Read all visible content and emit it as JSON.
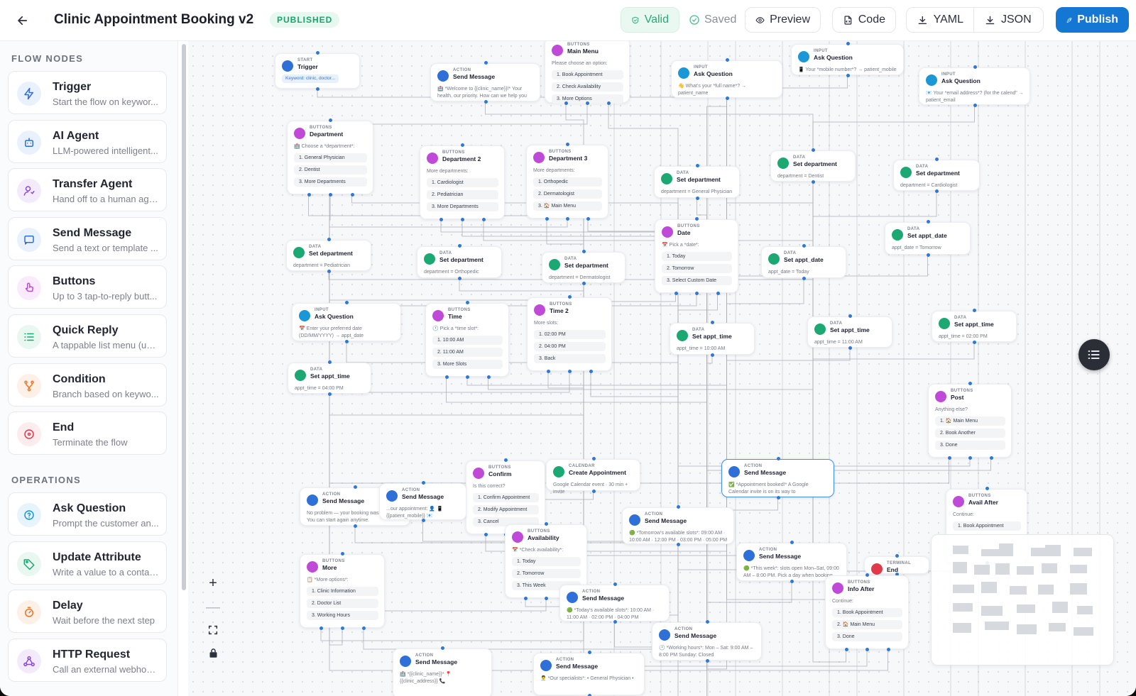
{
  "header": {
    "title": "Clinic Appointment Booking v2",
    "status": "PUBLISHED",
    "valid_label": "Valid",
    "saved_label": "Saved",
    "preview_label": "Preview",
    "code_label": "Code",
    "yaml_label": "YAML",
    "json_label": "JSON",
    "publish_label": "Publish"
  },
  "sidebar": {
    "flow_nodes_title": "FLOW NODES",
    "operations_title": "OPERATIONS",
    "flow_nodes": [
      {
        "name": "Trigger",
        "desc": "Start the flow on keywor...",
        "icon": "bolt-icon",
        "color": "#2f6fd8",
        "bg": "#e9f1fd"
      },
      {
        "name": "AI Agent",
        "desc": "LLM-powered intelligent...",
        "icon": "robot-icon",
        "color": "#2f6fd8",
        "bg": "#e9f1fd"
      },
      {
        "name": "Transfer Agent",
        "desc": "Hand off to a human age...",
        "icon": "person-icon",
        "color": "#8b47d6",
        "bg": "#f3ebfc"
      },
      {
        "name": "Send Message",
        "desc": "Send a text or template ...",
        "icon": "message-icon",
        "color": "#2f6fd8",
        "bg": "#e9f1fd"
      },
      {
        "name": "Buttons",
        "desc": "Up to 3 tap-to-reply butt...",
        "icon": "tap-icon",
        "color": "#c04ad8",
        "bg": "#f9ebfc"
      },
      {
        "name": "Quick Reply",
        "desc": "A tappable list menu (up...",
        "icon": "list-icon",
        "color": "#1ba873",
        "bg": "#e8f7f0"
      },
      {
        "name": "Condition",
        "desc": "Branch based on keywo...",
        "icon": "branch-icon",
        "color": "#e8762b",
        "bg": "#fdf0e6"
      },
      {
        "name": "End",
        "desc": "Terminate the flow",
        "icon": "stop-icon",
        "color": "#e0394a",
        "bg": "#fdecee"
      }
    ],
    "operations": [
      {
        "name": "Ask Question",
        "desc": "Prompt the customer an...",
        "icon": "question-icon",
        "color": "#1b96d6",
        "bg": "#e7f4fb"
      },
      {
        "name": "Update Attribute",
        "desc": "Write a value to a contac...",
        "icon": "tag-icon",
        "color": "#1ba873",
        "bg": "#e8f7f0"
      },
      {
        "name": "Delay",
        "desc": "Wait before the next step",
        "icon": "timer-icon",
        "color": "#e8762b",
        "bg": "#fdf0e6"
      },
      {
        "name": "HTTP Request",
        "desc": "Call an external webhoo...",
        "icon": "webhook-icon",
        "color": "#8b47d6",
        "bg": "#f3ebfc"
      }
    ]
  },
  "canvas": {
    "nodes": [
      {
        "kind": "START",
        "title": "Trigger",
        "chip": "Keyword: clinic, doctor...",
        "icon_color": "#2f6fd8"
      },
      {
        "kind": "ACTION",
        "title": "Send Message",
        "body": "🏥 *Welcome to {{clinic_name}}!* Your health, our priority. How can we help you today?",
        "icon_color": "#2f6fd8"
      },
      {
        "kind": "BUTTONS",
        "title": "Main Menu",
        "body": "Please choose an option:",
        "options": [
          "1. Book Appointment",
          "2. Check Availability",
          "3. More Options"
        ],
        "icon_color": "#c04ad8"
      },
      {
        "kind": "INPUT",
        "title": "Ask Question",
        "body": "👋 What's your *full name*? → patient_name",
        "icon_color": "#1b96d6"
      },
      {
        "kind": "INPUT",
        "title": "Ask Question",
        "body": "📱 Your *mobile number*? → patient_mobile",
        "icon_color": "#1b96d6"
      },
      {
        "kind": "INPUT",
        "title": "Ask Question",
        "body": "📧 Your *email address*? (for the calend\" → patient_email",
        "icon_color": "#1b96d6"
      },
      {
        "kind": "BUTTONS",
        "title": "Department",
        "body": "🏥 Choose a *department*:",
        "options": [
          "1. General Physician",
          "2. Dentist",
          "3. More Departments"
        ],
        "icon_color": "#c04ad8"
      },
      {
        "kind": "BUTTONS",
        "title": "Department 2",
        "body": "More departments:",
        "options": [
          "1. Cardiologist",
          "2. Pediatrician",
          "3. More Departments"
        ],
        "icon_color": "#c04ad8"
      },
      {
        "kind": "BUTTONS",
        "title": "Department 3",
        "body": "More departments:",
        "options": [
          "1. Orthopedic",
          "2. Dermatologist",
          "3. 🏠 Main Menu"
        ],
        "icon_color": "#c04ad8"
      },
      {
        "kind": "DATA",
        "title": "Set department",
        "body": "department = General Physician",
        "icon_color": "#1ba873"
      },
      {
        "kind": "DATA",
        "title": "Set department",
        "body": "department = Dentist",
        "icon_color": "#1ba873"
      },
      {
        "kind": "DATA",
        "title": "Set department",
        "body": "department = Cardiologist",
        "icon_color": "#1ba873"
      },
      {
        "kind": "BUTTONS",
        "title": "Date",
        "body": "📅 Pick a *date*:",
        "options": [
          "1. Today",
          "2. Tomorrow",
          "3. Select Custom Date"
        ],
        "icon_color": "#c04ad8"
      },
      {
        "kind": "DATA",
        "title": "Set appt_date",
        "body": "appt_date = Tomorrow",
        "icon_color": "#1ba873"
      },
      {
        "kind": "DATA",
        "title": "Set appt_date",
        "body": "appt_date = Today",
        "icon_color": "#1ba873"
      },
      {
        "kind": "DATA",
        "title": "Set department",
        "body": "department = Pediatrician",
        "icon_color": "#1ba873"
      },
      {
        "kind": "DATA",
        "title": "Set department",
        "body": "department = Orthopedic",
        "icon_color": "#1ba873"
      },
      {
        "kind": "DATA",
        "title": "Set department",
        "body": "department = Dermatologist",
        "icon_color": "#1ba873"
      },
      {
        "kind": "INPUT",
        "title": "Ask Question",
        "body": "📅 Enter your preferred date (DD/MM/YYYY) → appt_date",
        "icon_color": "#1b96d6"
      },
      {
        "kind": "BUTTONS",
        "title": "Time",
        "body": "🕐 Pick a *time slot*:",
        "options": [
          "1. 10:00 AM",
          "2. 11:00 AM",
          "3. More Slots"
        ],
        "icon_color": "#c04ad8"
      },
      {
        "kind": "BUTTONS",
        "title": "Time 2",
        "body": "More slots:",
        "options": [
          "1. 02:00 PM",
          "2. 04:00 PM",
          "3. Back"
        ],
        "icon_color": "#c04ad8"
      },
      {
        "kind": "DATA",
        "title": "Set appt_time",
        "body": "appt_time = 10:00 AM",
        "icon_color": "#1ba873"
      },
      {
        "kind": "DATA",
        "title": "Set appt_time",
        "body": "appt_time = 11:00 AM",
        "icon_color": "#1ba873"
      },
      {
        "kind": "DATA",
        "title": "Set appt_time",
        "body": "appt_time = 02:00 PM",
        "icon_color": "#1ba873"
      },
      {
        "kind": "DATA",
        "title": "Set appt_time",
        "body": "appt_time = 04:00 PM",
        "icon_color": "#1ba873"
      },
      {
        "kind": "BUTTONS",
        "title": "Post",
        "body": "Anything else?",
        "options": [
          "1. 🏠 Main Menu",
          "2. Book Another",
          "3. Done"
        ],
        "icon_color": "#c04ad8"
      },
      {
        "kind": "BUTTONS",
        "title": "Confirm",
        "body": "Is this correct?",
        "options": [
          "1. Confirm Appointment",
          "2. Modify Appointment",
          "3. Cancel"
        ],
        "icon_color": "#c04ad8"
      },
      {
        "kind": "CALENDAR",
        "title": "Create Appointment",
        "body": "Google Calendar event · 30 min + invite",
        "icon_color": "#1ba873"
      },
      {
        "kind": "ACTION",
        "title": "Send Message",
        "body": "✅ *Appointment booked!* A Google Calendar invite is on its way to {{patient_email}} — tap...",
        "icon_color": "#2f6fd8"
      },
      {
        "kind": "ACTION",
        "title": "Send Message",
        "body": "No problem — your booking was cancelled. You can start again anytime.",
        "icon_color": "#2f6fd8"
      },
      {
        "kind": "ACTION",
        "title": "Send Message",
        "body": "...our appointment: 👤 📱 {{patient_mobile}} 📧",
        "icon_color": "#2f6fd8"
      },
      {
        "kind": "ACTION",
        "title": "Send Message",
        "body": "🟢 *Tomorrow's available slots*: 09:00 AM · 10:00 AM · 12:00 PM · 03:00 PM · 05:00 PM",
        "icon_color": "#2f6fd8"
      },
      {
        "kind": "BUTTONS",
        "title": "Availability",
        "body": "📅 *Check availability*:",
        "options": [
          "1. Today",
          "2. Tomorrow",
          "3. This Week"
        ],
        "icon_color": "#c04ad8"
      },
      {
        "kind": "ACTION",
        "title": "Send Message",
        "body": "🟢 *This week*: slots open Mon–Sat, 09:00 AM – 8:00 PM. Pick a day when booking.",
        "icon_color": "#2f6fd8"
      },
      {
        "kind": "TERMINAL",
        "title": "End",
        "icon_color": "#e0394a"
      },
      {
        "kind": "BUTTONS",
        "title": "Avail After",
        "body": "Continue:",
        "options": [
          "1. Book Appointment"
        ],
        "icon_color": "#c04ad8"
      },
      {
        "kind": "BUTTONS",
        "title": "More",
        "body": "📋 *More options*:",
        "options": [
          "1. Clinic Information",
          "2. Doctor List",
          "3. Working Hours"
        ],
        "icon_color": "#c04ad8"
      },
      {
        "kind": "ACTION",
        "title": "Send Message",
        "body": "🟢 *Today's available slots*: 10:00 AM · 11:00 AM · 02:00 PM · 04:00 PM",
        "icon_color": "#2f6fd8"
      },
      {
        "kind": "ACTION",
        "title": "Send Message",
        "body": "🕐 *Working hours*: Mon – Sat: 9:00 AM – 8:00 PM Sunday: Closed",
        "icon_color": "#2f6fd8"
      },
      {
        "kind": "BUTTONS",
        "title": "Info After",
        "body": "Continue:",
        "options": [
          "1. Book Appointment",
          "2. 🏠 Main Menu",
          "3. Done"
        ],
        "icon_color": "#c04ad8"
      },
      {
        "kind": "ACTION",
        "title": "Send Message",
        "body": "🏥 *{{clinic_name}}* 📍 {{clinic_address}} 📞",
        "icon_color": "#2f6fd8"
      },
      {
        "kind": "ACTION",
        "title": "Send Message",
        "body": "👨‍⚕️ *Our specialists*: • General Physician •",
        "icon_color": "#2f6fd8"
      }
    ]
  }
}
